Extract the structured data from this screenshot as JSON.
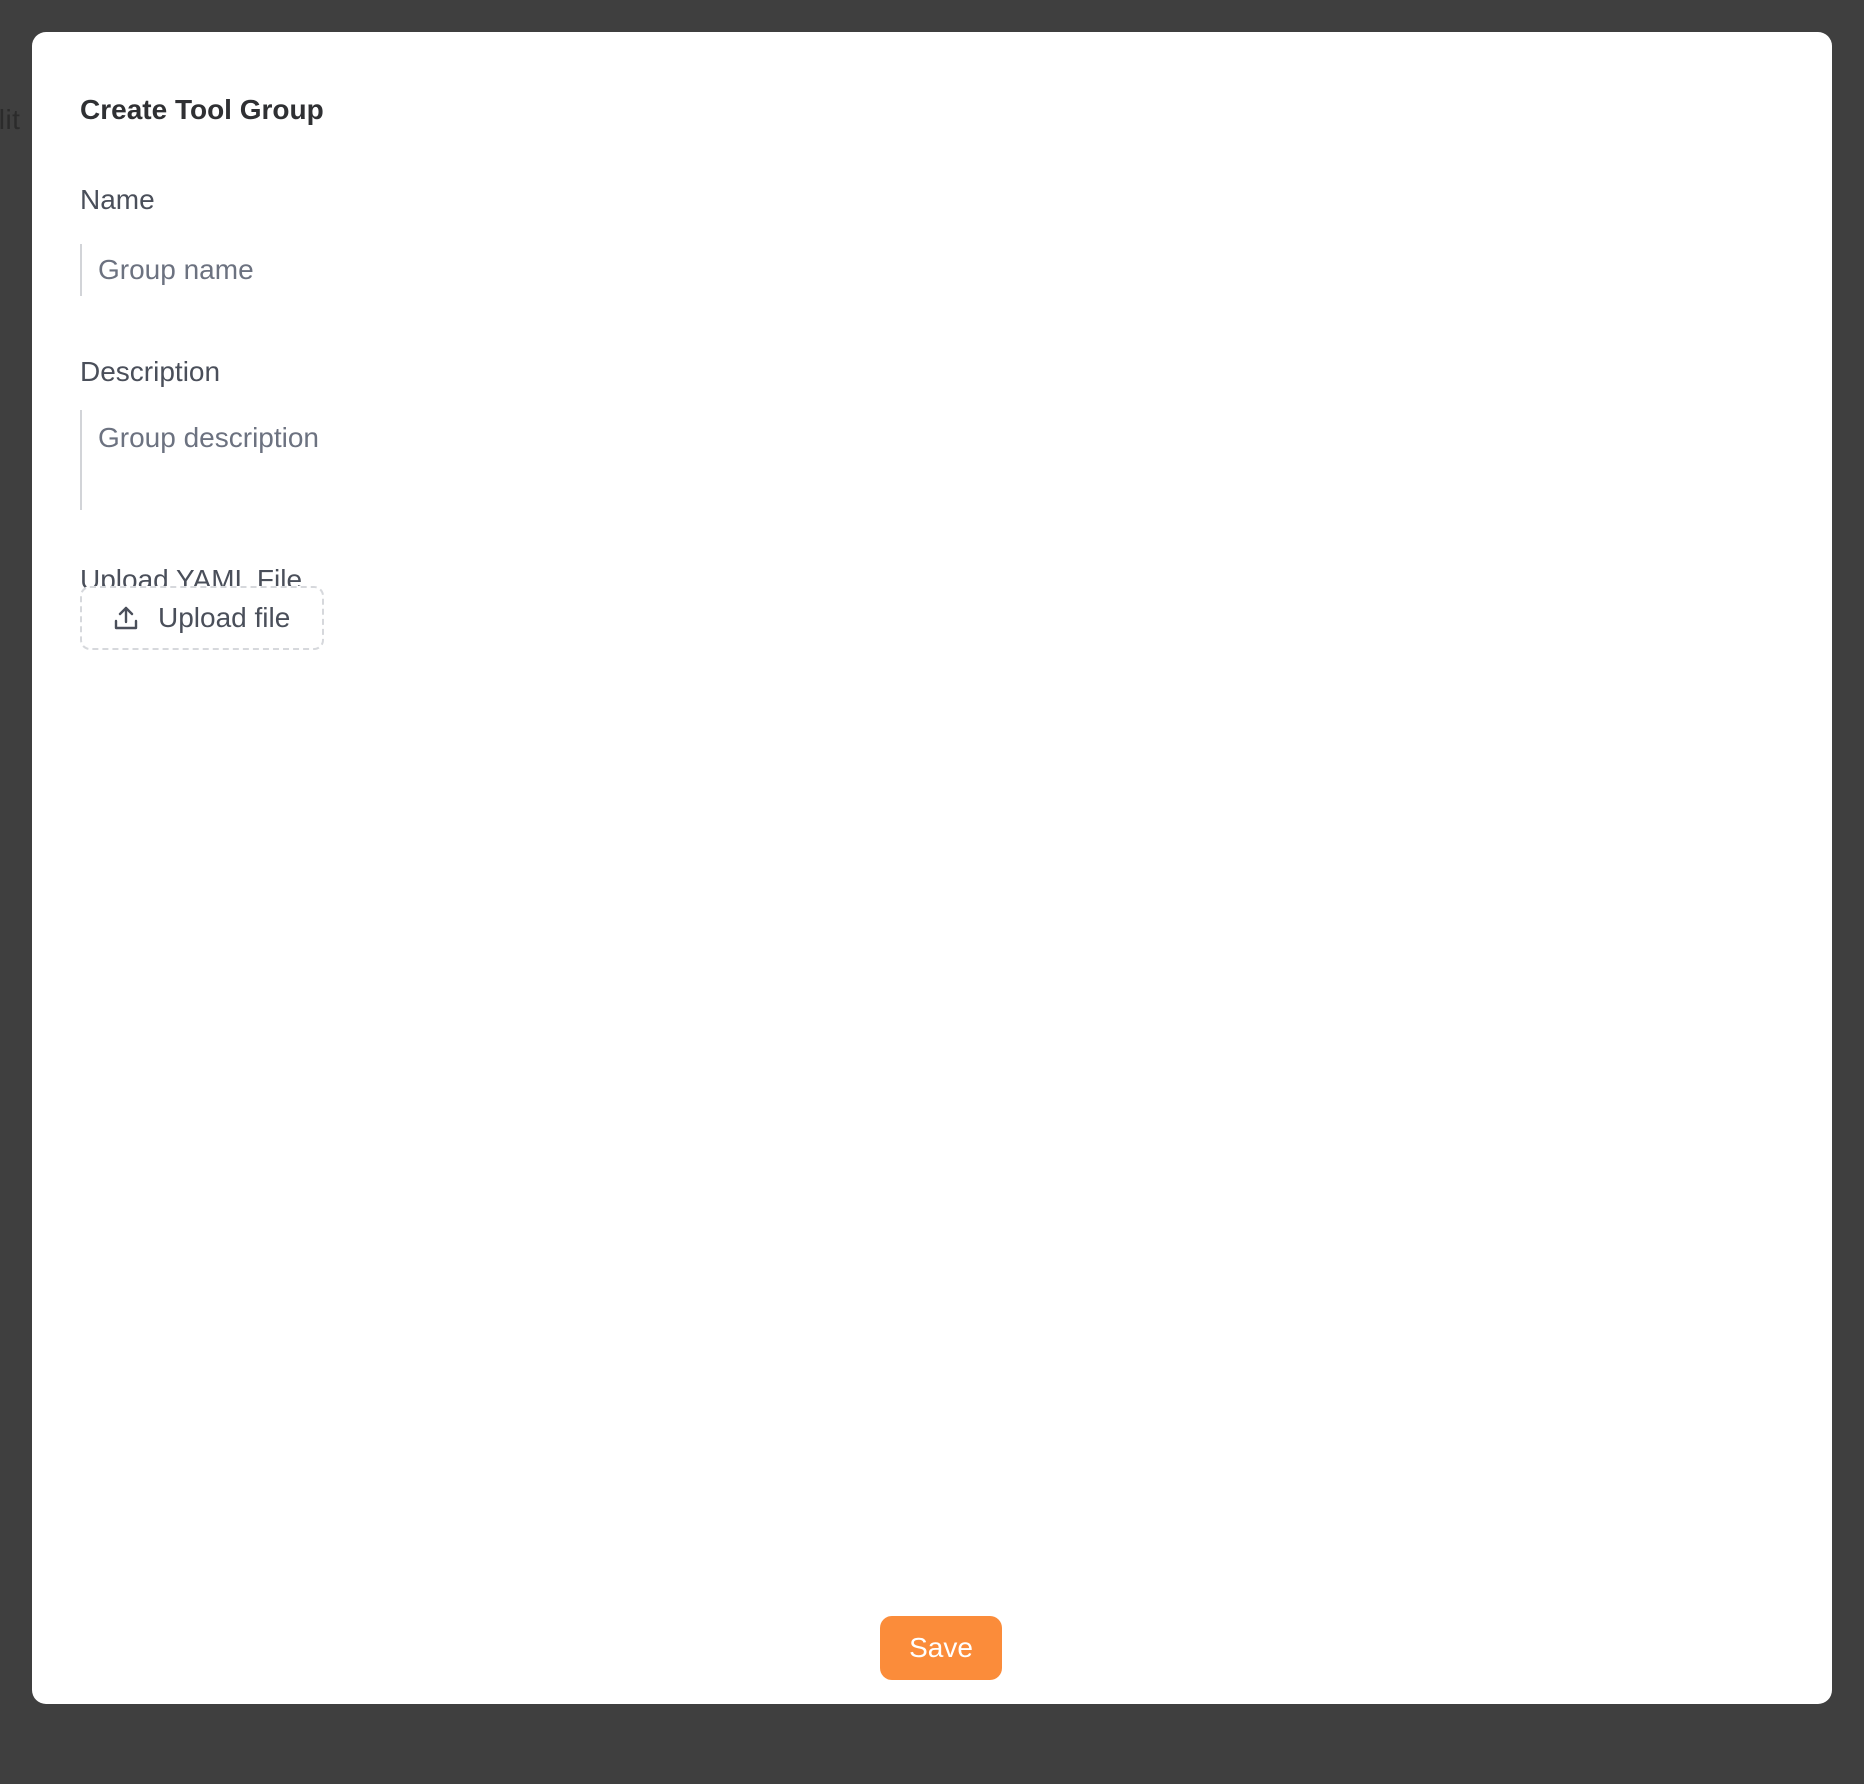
{
  "backdrop": {
    "partial_text": "ilit"
  },
  "dialog": {
    "title": "Create Tool Group",
    "name_field": {
      "label": "Name",
      "placeholder": "Group name",
      "value": ""
    },
    "description_field": {
      "label": "Description",
      "placeholder": "Group description",
      "value": ""
    },
    "upload": {
      "label": "Upload YAML File",
      "button_label": "Upload file",
      "icon": "upload-icon"
    },
    "save_label": "Save"
  },
  "colors": {
    "accent": "#fb8c3a",
    "overlay": "#3f3f3f",
    "dialog_background": "#ffffff"
  }
}
